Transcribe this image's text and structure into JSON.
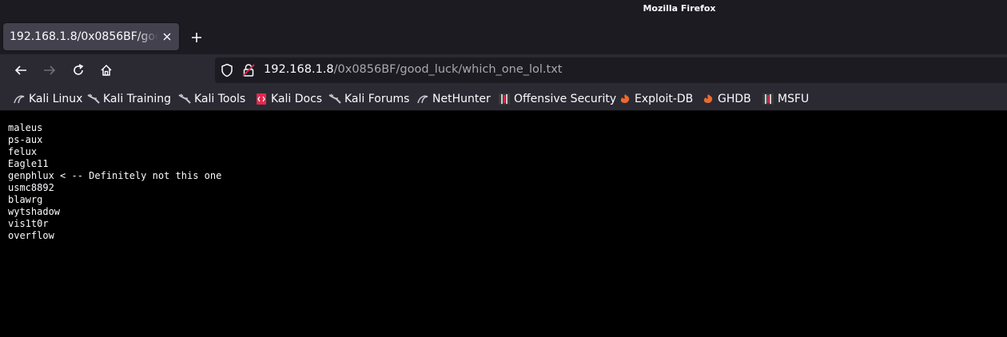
{
  "window": {
    "title": "Mozilla Firefox"
  },
  "tab": {
    "title": "192.168.1.8/0x0856BF/good_luck/which_one_lol.txt"
  },
  "url": {
    "host": "192.168.1.8",
    "path": "/0x0856BF/good_luck/which_one_lol.txt"
  },
  "bookmarks": [
    {
      "label": "Kali Linux",
      "icon": "kali-dragon-icon"
    },
    {
      "label": "Kali Training",
      "icon": "kali-dragon-icon"
    },
    {
      "label": "Kali Tools",
      "icon": "kali-dragon-icon"
    },
    {
      "label": "Kali Docs",
      "icon": "kali-docs-icon"
    },
    {
      "label": "Kali Forums",
      "icon": "kali-dragon-icon"
    },
    {
      "label": "NetHunter",
      "icon": "kali-dragon-icon"
    },
    {
      "label": "Offensive Security",
      "icon": "offsec-icon"
    },
    {
      "label": "Exploit-DB",
      "icon": "exploitdb-icon"
    },
    {
      "label": "GHDB",
      "icon": "exploitdb-icon"
    },
    {
      "label": "MSFU",
      "icon": "offsec-icon"
    }
  ],
  "file_lines": [
    "maleus",
    "ps-aux",
    "felux",
    "Eagle11",
    "genphlux < -- Definitely not this one",
    "usmc8892",
    "blawrg",
    "wytshadow",
    "vis1t0r",
    "overflow"
  ],
  "colors": {
    "toolbar": "#2b2a33",
    "tabstrip": "#1c1b22",
    "lock_warning": "#e22850",
    "exploitdb_orange": "#ec6a2e"
  }
}
